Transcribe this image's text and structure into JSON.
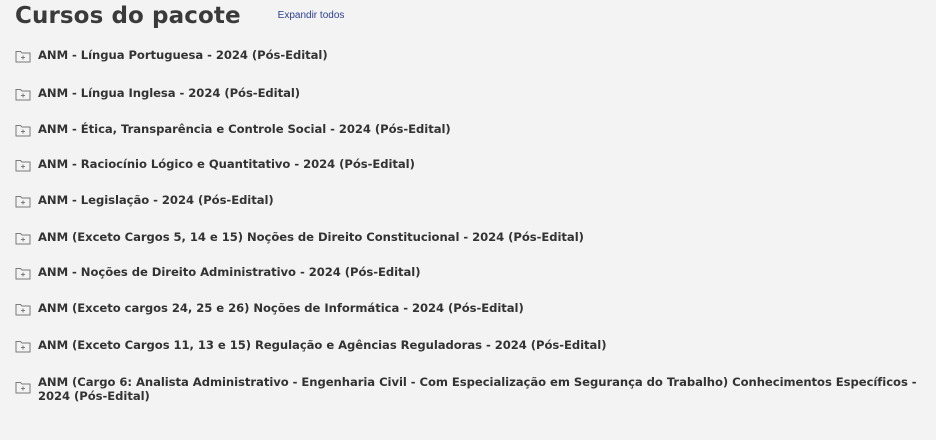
{
  "header": {
    "title": "Cursos do pacote",
    "expand_all_label": "Expandir todos"
  },
  "icons": {
    "item_icon": "folder-plus-icon"
  },
  "colors": {
    "background": "#f3f3f3",
    "text": "#333333",
    "link": "#2c3e8f",
    "icon": "#7a7a7a"
  },
  "courses": [
    {
      "label": "ANM - Língua Portuguesa - 2024 (Pós-Edital)"
    },
    {
      "label": "ANM - Língua Inglesa - 2024 (Pós-Edital)"
    },
    {
      "label": "ANM - Ética, Transparência e Controle Social - 2024 (Pós-Edital)"
    },
    {
      "label": "ANM - Raciocínio Lógico e Quantitativo - 2024 (Pós-Edital)"
    },
    {
      "label": "ANM - Legislação - 2024 (Pós-Edital)"
    },
    {
      "label": "ANM (Exceto Cargos 5, 14 e 15) Noções de Direito Constitucional - 2024 (Pós-Edital)"
    },
    {
      "label": "ANM - Noções de Direito Administrativo - 2024 (Pós-Edital)"
    },
    {
      "label": "ANM (Exceto cargos 24, 25 e 26) Noções de Informática - 2024 (Pós-Edital)"
    },
    {
      "label": "ANM (Exceto Cargos 11, 13 e 15) Regulação e Agências Reguladoras - 2024 (Pós-Edital)"
    },
    {
      "label": "ANM (Cargo 6: Analista Administrativo - Engenharia Civil - Com Especialização em Segurança do Trabalho) Conhecimentos Específicos - 2024 (Pós-Edital)"
    }
  ]
}
